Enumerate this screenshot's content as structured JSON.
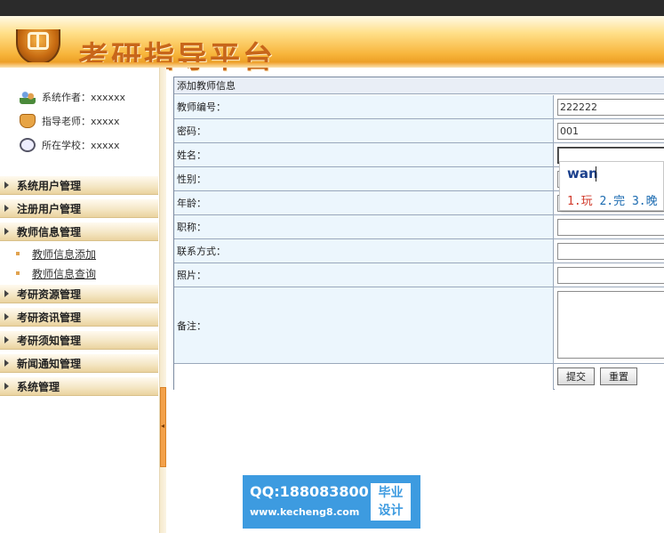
{
  "app": {
    "title": "考研指导平台"
  },
  "sidebar": {
    "info": [
      {
        "label": "系统作者：",
        "value": "xxxxxx"
      },
      {
        "label": "指导老师：",
        "value": "xxxxx"
      },
      {
        "label": "所在学校：",
        "value": "xxxxx"
      }
    ],
    "menu": [
      {
        "label": "系统用户管理"
      },
      {
        "label": "注册用户管理"
      },
      {
        "label": "教师信息管理",
        "sub": [
          "教师信息添加",
          "教师信息查询"
        ]
      },
      {
        "label": "考研资源管理"
      },
      {
        "label": "考研资讯管理"
      },
      {
        "label": "考研须知管理"
      },
      {
        "label": "新闻通知管理"
      },
      {
        "label": "系统管理"
      }
    ]
  },
  "form": {
    "title": "添加教师信息",
    "fields": {
      "number": {
        "label": "教师编号：",
        "value": "222222"
      },
      "password": {
        "label": "密码：",
        "value": "001"
      },
      "name": {
        "label": "姓名：",
        "value": ""
      },
      "gender": {
        "label": "性别：",
        "value": ""
      },
      "age": {
        "label": "年龄：",
        "value": ""
      },
      "title": {
        "label": "职称：",
        "value": ""
      },
      "contact": {
        "label": "联系方式：",
        "value": ""
      },
      "photo": {
        "label": "照片：",
        "value": ""
      },
      "remark": {
        "label": "备注：",
        "value": ""
      }
    },
    "submit_label": "提交",
    "reset_label": "重置"
  },
  "ime": {
    "composition": "wan",
    "candidates": [
      "1.玩",
      "2.完",
      "3.晚"
    ]
  },
  "watermark": {
    "qq": "QQ:188083800",
    "url": "www.kecheng8.com",
    "badge_line1": "毕业",
    "badge_line2": "设计"
  },
  "colors": {
    "header_orange": "#f7b43a",
    "title_text": "#c8661a",
    "label_bg": "#ecf6fd",
    "watermark_blue": "#3d9be0"
  }
}
